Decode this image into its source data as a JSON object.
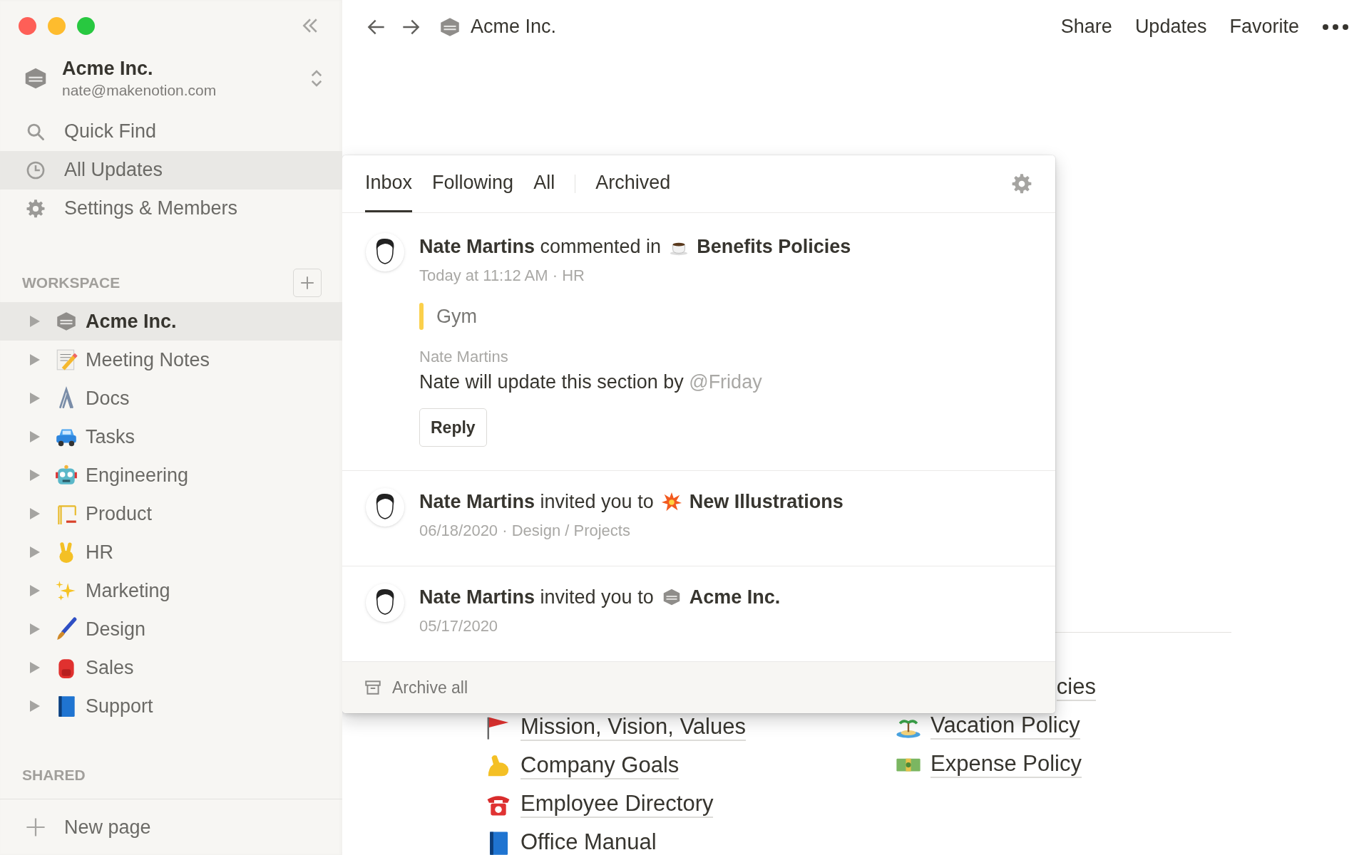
{
  "sidebar": {
    "workspace": {
      "name": "Acme Inc.",
      "email": "nate@makenotion.com"
    },
    "nav": [
      {
        "label": "Quick Find",
        "selected": false
      },
      {
        "label": "All Updates",
        "selected": true
      },
      {
        "label": "Settings & Members",
        "selected": false
      }
    ],
    "workspace_section": {
      "title": "WORKSPACE",
      "pages": [
        {
          "label": "Acme Inc.",
          "selected": true
        },
        {
          "label": "Meeting Notes",
          "selected": false
        },
        {
          "label": "Docs",
          "selected": false
        },
        {
          "label": "Tasks",
          "selected": false
        },
        {
          "label": "Engineering",
          "selected": false
        },
        {
          "label": "Product",
          "selected": false
        },
        {
          "label": "HR",
          "selected": false
        },
        {
          "label": "Marketing",
          "selected": false
        },
        {
          "label": "Design",
          "selected": false
        },
        {
          "label": "Sales",
          "selected": false
        },
        {
          "label": "Support",
          "selected": false
        }
      ]
    },
    "shared_section": {
      "title": "SHARED"
    },
    "new_page": "New page"
  },
  "topbar": {
    "breadcrumb": "Acme Inc.",
    "actions": [
      "Share",
      "Updates",
      "Favorite"
    ]
  },
  "updates_panel": {
    "tabs": [
      {
        "label": "Inbox",
        "selected": true
      },
      {
        "label": "Following",
        "selected": false
      },
      {
        "label": "All",
        "selected": false
      },
      {
        "label": "Archived",
        "selected": false
      }
    ],
    "items": [
      {
        "kind": "comment",
        "summary": "**Nate Martins** commented in",
        "page": "Benefits Policies",
        "meta": "Today at 11:12 AM · HR",
        "quote": "Gym",
        "comment_author": "Nate Martins",
        "comment": "Nate will update this section by",
        "mention": "@Friday",
        "reply": "Reply"
      },
      {
        "kind": "invite",
        "summary": "**Nate Martins** invited you to",
        "page": "New Illustrations",
        "meta": "06/18/2020 · Design / Projects"
      },
      {
        "kind": "invite",
        "summary": "**Nate Martins** invited you to",
        "page": "Acme Inc.",
        "meta": "05/17/2020"
      }
    ],
    "archive_all": "Archive all"
  },
  "page": {
    "links_left": [
      "Mission, Vision, Values",
      "Company Goals",
      "Employee Directory",
      "Office Manual"
    ],
    "links_right": [
      "cies",
      "Vacation Policy",
      "Expense Policy"
    ]
  }
}
